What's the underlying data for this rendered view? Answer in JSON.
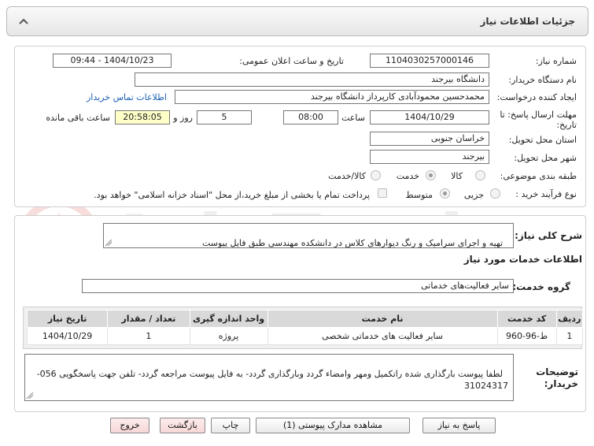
{
  "header": {
    "title": "جزئیات اطلاعات نیاز"
  },
  "form": {
    "need_number_label": "شماره نیاز:",
    "need_number": "1104030257000146",
    "announce_label": "تاریخ و ساعت اعلان عمومی:",
    "announce_value": "1404/10/23 - 09:44",
    "buyer_org_label": "نام دستگاه خریدار:",
    "buyer_org": "دانشگاه بیرجند",
    "creator_label": "ایجاد کننده درخواست:",
    "creator": "محمدحسین محمودآبادی کارپرداز دانشگاه بیرجند",
    "contact_link": "اطلاعات تماس خریدار",
    "deadline_label_1": "مهلت ارسال پاسخ: تا",
    "deadline_label_2": "تاریخ:",
    "deadline_date": "1404/10/29",
    "time_label": "ساعت",
    "deadline_time": "08:00",
    "days_value": "5",
    "days_label": "روز و",
    "remaining_time": "20:58:05",
    "remaining_label": "ساعت باقی مانده",
    "province_label": "استان محل تحویل:",
    "province": "خراسان جنوبی",
    "city_label": "شهر محل تحویل:",
    "city": "بیرجند",
    "category_label": "طبقه بندی موضوعی:",
    "category_options": [
      "کالا",
      "خدمت",
      "کالا/خدمت"
    ],
    "process_label": "نوع فرآیند خرید :",
    "process_options": [
      "جزیی",
      "متوسط"
    ],
    "payment_note": "پرداخت تمام یا بخشی از مبلغ خرید،از محل \"اسناد خزانه اسلامی\" خواهد بود."
  },
  "needs": {
    "general_desc_label": "شرح کلی نیاز:",
    "general_desc": "تهیه و اجرای سرامیک و رنگ دیوارهای کلاس در دانشکده مهندسی طبق فایل پیوست",
    "services_info_title": "اطلاعات خدمات مورد نیاز",
    "service_group_label": "گروه خدمت:",
    "service_group": "سایر فعالیت‌های خدماتی"
  },
  "table": {
    "headers": [
      "ردیف",
      "کد خدمت",
      "نام خدمت",
      "واحد اندازه گیری",
      "تعداد / مقدار",
      "تاریخ نیاز"
    ],
    "rows": [
      [
        "1",
        "ط-96-960",
        "سایر فعالیت های خدماتی شخصی",
        "پروژه",
        "1",
        "1404/10/29"
      ]
    ]
  },
  "buyer_notes": {
    "label_1": "توضیحات",
    "label_2": "خریدار:",
    "text": "لطفا پیوست بارگذاری شده راتکمیل ومهر وامضاء گردد وبارگذاری گردد- به فایل پیوست مراجعه گردد- تلفن جهت پاسخگویی 056- 31024317"
  },
  "buttons": {
    "reply": "پاسخ به نیاز",
    "attachments": "مشاهده مدارک پیوستی (1)",
    "print": "چاپ",
    "back": "بازگشت",
    "exit": "خروج"
  },
  "colors": {
    "header_bg": "#e6e6e6",
    "table_header_bg": "#d9d9d9",
    "remaining_bg": "#ffffc8",
    "link": "#1a5fb4",
    "pink_button": "#f7d7d7"
  }
}
